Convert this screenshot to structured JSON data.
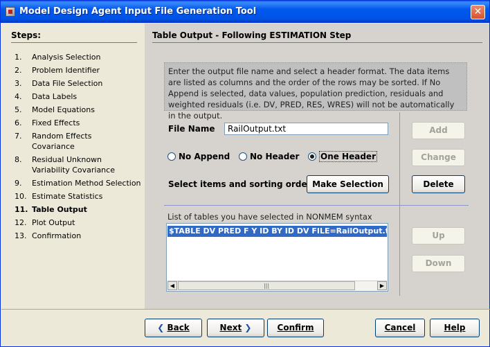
{
  "window": {
    "title": "Model Design Agent Input File Generation Tool",
    "close_label": "✕"
  },
  "steps": {
    "title": "Steps:",
    "items": [
      {
        "num": "1.",
        "lines": [
          "Analysis Selection"
        ]
      },
      {
        "num": "2.",
        "lines": [
          "Problem Identifier"
        ]
      },
      {
        "num": "3.",
        "lines": [
          "Data File Selection"
        ]
      },
      {
        "num": "4.",
        "lines": [
          "Data Labels"
        ]
      },
      {
        "num": "5.",
        "lines": [
          "Model Equations"
        ]
      },
      {
        "num": "6.",
        "lines": [
          "Fixed Effects"
        ]
      },
      {
        "num": "7.",
        "lines": [
          "Random Effects",
          "Covariance"
        ]
      },
      {
        "num": "8.",
        "lines": [
          "Residual Unknown",
          "Variability Covariance"
        ]
      },
      {
        "num": "9.",
        "lines": [
          "Estimation Method Selection"
        ]
      },
      {
        "num": "10.",
        "lines": [
          "Estimate Statistics"
        ]
      },
      {
        "num": "11.",
        "lines": [
          "Table Output"
        ]
      },
      {
        "num": "12.",
        "lines": [
          "Plot Output"
        ]
      },
      {
        "num": "13.",
        "lines": [
          "Confirmation"
        ]
      }
    ],
    "active_index": 10
  },
  "main": {
    "title": "Table Output - Following ESTIMATION Step",
    "info": "Enter the output file name and select a header format.  The data items are listed as columns and the order of the rows may be sorted.  If No Append is selected, data values, population prediction, residuals and weighted residuals (i.e. DV, PRED, RES, WRES) will not be automatically in the output.",
    "file_name_label": "File Name",
    "file_name_value": "RailOutput.txt",
    "radios": [
      {
        "label": "No Append",
        "checked": false
      },
      {
        "label": "No Header",
        "checked": false
      },
      {
        "label": "One Header",
        "checked": true
      }
    ],
    "select_label": "Select items and sorting orders",
    "make_selection": "Make Selection",
    "add": "Add",
    "change": "Change",
    "delete": "Delete",
    "up": "Up",
    "down": "Down",
    "list_label": "List of tables you have selected in NONMEM syntax",
    "list_items": [
      "$TABLE DV PRED F Y ID BY ID DV FILE=RailOutput.txt ONE"
    ]
  },
  "footer": {
    "back": "Back",
    "next": "Next",
    "confirm": "Confirm",
    "cancel": "Cancel",
    "help": "Help"
  }
}
